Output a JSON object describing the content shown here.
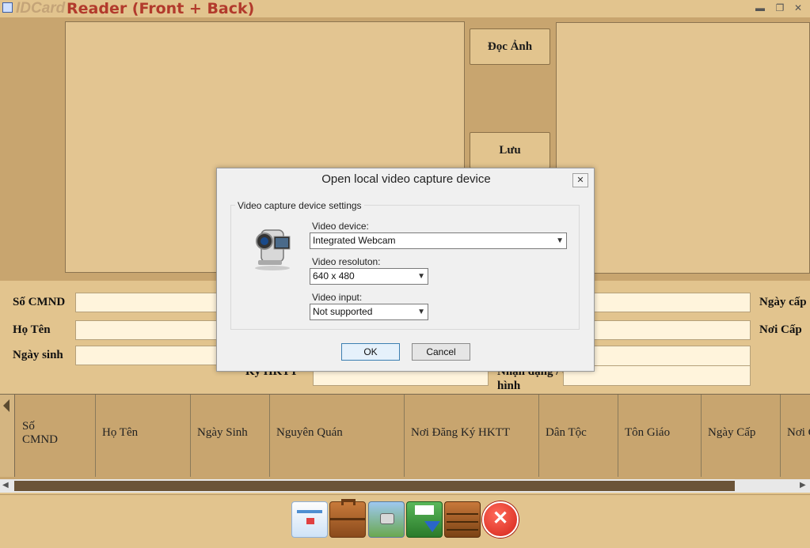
{
  "app": {
    "title_brand": "IDCard",
    "title_rest": "Reader (Front + Back)"
  },
  "buttons": {
    "read_image": "Đọc Ảnh",
    "save": "Lưu"
  },
  "form": {
    "id_number_label": "Số CMND",
    "full_name_label": "Họ Tên",
    "birth_date_label": "Ngày sinh",
    "issue_date_label": "Ngày cấp",
    "issue_place_label": "Nơi Cấp",
    "hktt_label": "Ký HKTT",
    "features_label_line1": "Nhận dạng / đặc điểm",
    "features_label_line2": "hình"
  },
  "grid": {
    "columns": [
      "Số CMND",
      "Họ Tên",
      "Ngày Sinh",
      "Nguyên Quán",
      "Nơi Đăng Ký HKTT",
      "Dân Tộc",
      "Tôn Giáo",
      "Ngày Cấp",
      "Nơi Cấp"
    ]
  },
  "toolbar": {
    "icons": [
      "window-icon",
      "briefcase-icon",
      "photo-icon",
      "save-icon",
      "archive-icon",
      "close-icon"
    ]
  },
  "dialog": {
    "title": "Open local  video capture device",
    "group_label": "Video capture device settings",
    "device_label": "Video device:",
    "device_value": "Integrated Webcam",
    "resolution_label": "Video resoluton:",
    "resolution_value": "640 x 480",
    "input_label": "Video input:",
    "input_value": "Not supported",
    "ok": "OK",
    "cancel": "Cancel"
  },
  "colors": {
    "background": "#e2c48e",
    "panel": "#c8a56f",
    "title_accent": "#b23a2c",
    "close_button": "#e0382c"
  }
}
